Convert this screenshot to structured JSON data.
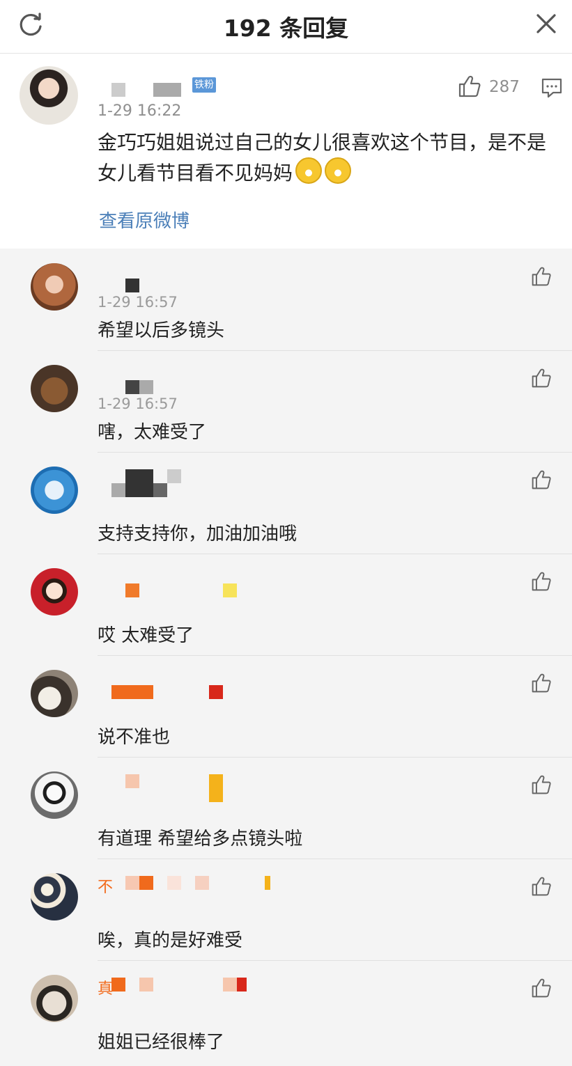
{
  "header": {
    "title": "192 条回复",
    "refresh_icon": "refresh-icon",
    "close_icon": "close-icon"
  },
  "main_post": {
    "badge": "铁粉",
    "time": "1-29 16:22",
    "like_count": "287",
    "content": "金巧巧姐姐说过自己的女儿很喜欢这个节目，是不是女儿看节目看不见妈妈",
    "emoji_count": 2,
    "view_link": "查看原微博"
  },
  "replies": [
    {
      "time": "1-29 16:57",
      "text": "希望以后多镜头"
    },
    {
      "time": "1-29 16:57",
      "text": "嗐，太难受了"
    },
    {
      "time": "",
      "text": "支持支持你，加油加油哦"
    },
    {
      "time": "",
      "text": "哎 太难受了"
    },
    {
      "time": "",
      "text": "说不准也"
    },
    {
      "time": "",
      "text": "有道理 希望给多点镜头啦"
    },
    {
      "time": "",
      "text": "唉，真的是好难受"
    },
    {
      "time": "",
      "text": "姐姐已经很棒了"
    }
  ],
  "nick_fragments": {
    "reply_7": "不",
    "reply_8": "真"
  },
  "colors": {
    "link": "#4b7fb8",
    "badge": "#5b97d8",
    "nick_orange": "#f26a1b"
  }
}
